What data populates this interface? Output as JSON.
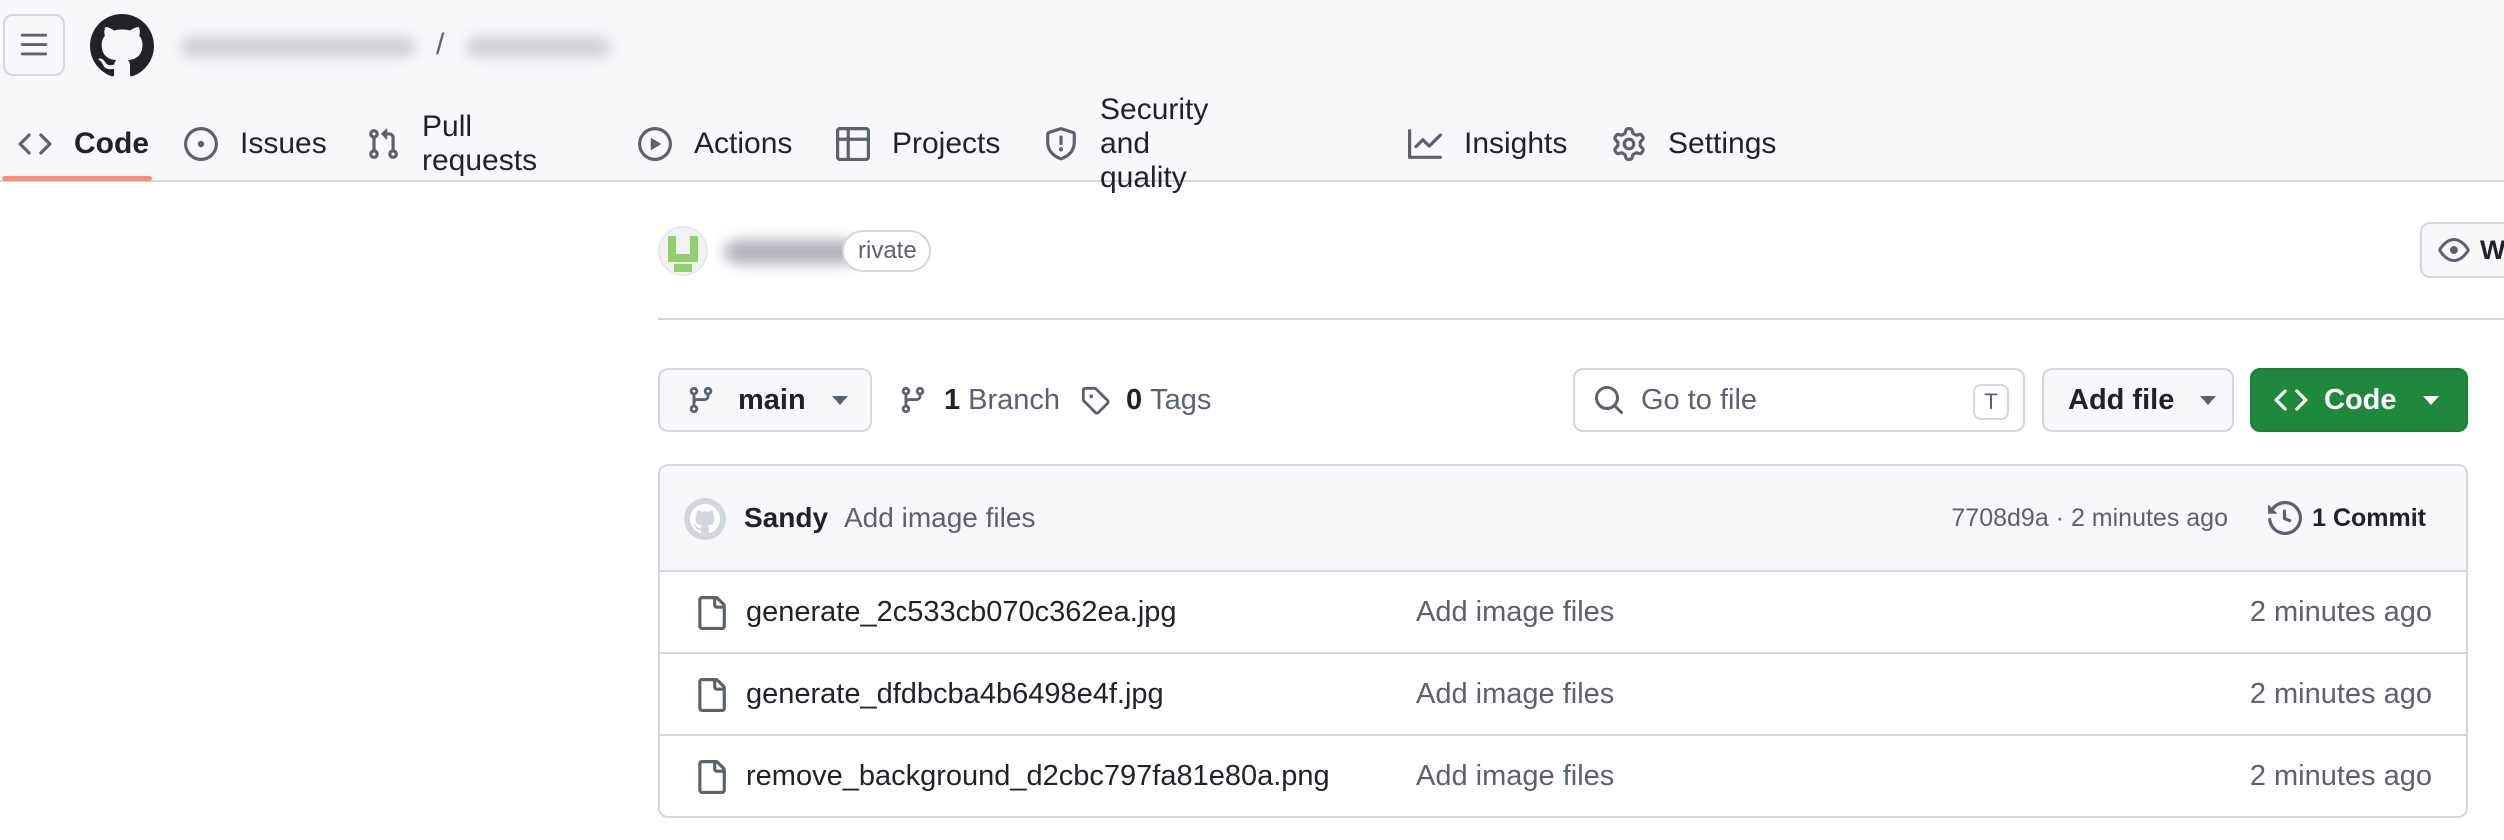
{
  "header": {
    "menu_icon": "hamburger-icon",
    "logo_icon": "github-mark-icon",
    "breadcrumb_separator": "/"
  },
  "nav": {
    "tabs": [
      {
        "label": "Code",
        "icon": "code-icon",
        "active": true
      },
      {
        "label": "Issues",
        "icon": "issue-opened-icon"
      },
      {
        "label": "Pull requests",
        "icon": "git-pull-request-icon"
      },
      {
        "label": "Actions",
        "icon": "play-icon"
      },
      {
        "label": "Projects",
        "icon": "table-icon"
      },
      {
        "label": "Security and quality",
        "icon": "shield-icon"
      },
      {
        "label": "Insights",
        "icon": "graph-icon"
      },
      {
        "label": "Settings",
        "icon": "gear-icon"
      }
    ],
    "active_color": "#fd8c73"
  },
  "repo": {
    "visibility": "rivate",
    "watch_label": "Wa"
  },
  "toolbar": {
    "branch": "main",
    "branch_count": "1",
    "branch_label": "Branch",
    "tag_count": "0",
    "tag_label": "Tags",
    "search_placeholder": "Go to file",
    "search_shortcut": "T",
    "add_file_label": "Add file",
    "code_label": "Code",
    "code_color": "#1f883d"
  },
  "latest_commit": {
    "author": "Sandy",
    "message": "Add image files",
    "meta": "7708d9a · 2 minutes ago",
    "count_label": "1 Commit"
  },
  "files": [
    {
      "name": "generate_2c533cb070c362ea.jpg",
      "message": "Add image files",
      "time": "2 minutes ago"
    },
    {
      "name": "generate_dfdbcba4b6498e4f.jpg",
      "message": "Add image files",
      "time": "2 minutes ago"
    },
    {
      "name": "remove_background_d2cbc797fa81e80a.png",
      "message": "Add image files",
      "time": "2 minutes ago"
    }
  ]
}
